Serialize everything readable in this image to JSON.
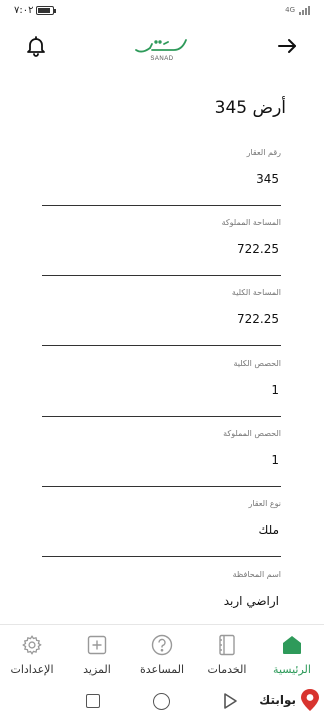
{
  "status": {
    "time": "٧:٠٢",
    "network": "4G"
  },
  "header": {
    "logo_text": "SANAD"
  },
  "page": {
    "title": "أرض 345"
  },
  "fields": [
    {
      "label": "رقم العقار",
      "value": "345"
    },
    {
      "label": "المساحة المملوكة",
      "value": "722.25"
    },
    {
      "label": "المساحة الكلية",
      "value": "722.25"
    },
    {
      "label": "الحصص الكلية",
      "value": "1"
    },
    {
      "label": "الحصص المملوكة",
      "value": "1"
    },
    {
      "label": "نوع العقار",
      "value": "ملك"
    },
    {
      "label": "اسم المحافظة",
      "value": "اراضي اربد"
    }
  ],
  "nav": {
    "items": [
      {
        "label": "الإعدادات",
        "icon": "gear-icon"
      },
      {
        "label": "المزيد",
        "icon": "plus-square-icon"
      },
      {
        "label": "المساعدة",
        "icon": "help-circle-icon"
      },
      {
        "label": "الخدمات",
        "icon": "services-icon"
      },
      {
        "label": "الرئيسية",
        "icon": "home-icon"
      }
    ],
    "active": "الرئيسية"
  },
  "watermark": {
    "text": "بوابتك"
  },
  "colors": {
    "accent": "#2e9a5a",
    "text": "#111111",
    "label": "#777777"
  }
}
